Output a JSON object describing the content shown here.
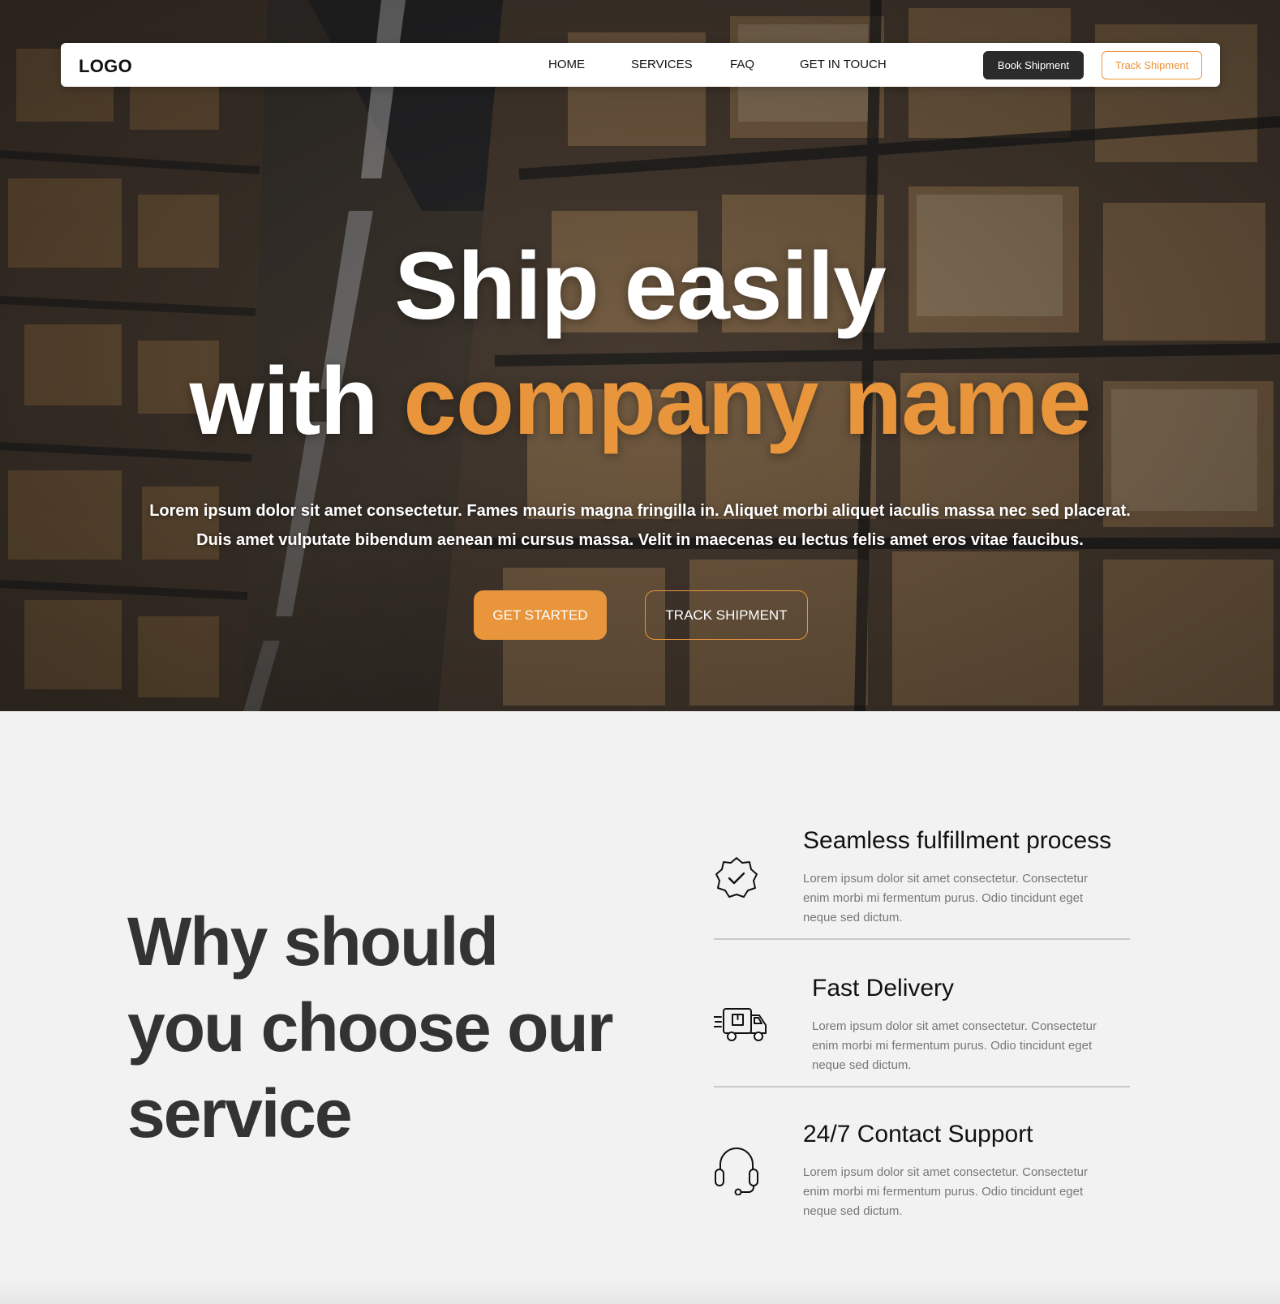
{
  "nav": {
    "logo": "LOGO",
    "links": [
      "HOME",
      "SERVICES",
      "FAQ",
      "GET IN TOUCH"
    ],
    "book_label": "Book Shipment",
    "track_label": "Track Shipment"
  },
  "hero": {
    "title_line1": "Ship easily",
    "title_with": "with ",
    "title_accent": "company name",
    "subtitle_line1": "Lorem ipsum dolor sit amet consectetur. Fames mauris magna fringilla in. Aliquet morbi aliquet iaculis massa nec sed placerat.",
    "subtitle_line2": "Duis amet vulputate bibendum aenean mi cursus massa. Velit in maecenas eu lectus felis amet eros vitae faucibus.",
    "cta_primary": "GET STARTED",
    "cta_secondary": "TRACK SHIPMENT"
  },
  "why": {
    "title_line1": "Why should",
    "title_line2": "you choose our",
    "title_line3": "service",
    "features": [
      {
        "icon": "verified-badge-icon",
        "title": "Seamless fulfillment process",
        "text": "Lorem ipsum dolor sit amet consectetur. Consectetur enim morbi mi fermentum purus. Odio tincidunt eget neque sed dictum."
      },
      {
        "icon": "delivery-truck-icon",
        "title": "Fast Delivery",
        "text": "Lorem ipsum dolor sit amet consectetur. Consectetur enim morbi mi fermentum purus. Odio tincidunt eget neque sed dictum."
      },
      {
        "icon": "headset-icon",
        "title": "24/7 Contact Support",
        "text": "Lorem ipsum dolor sit amet consectetur. Consectetur enim morbi mi fermentum purus. Odio tincidunt eget neque sed dictum."
      }
    ]
  },
  "colors": {
    "accent": "#e8953c",
    "dark": "#2b2b2b",
    "section_bg": "#f2f2f2"
  }
}
